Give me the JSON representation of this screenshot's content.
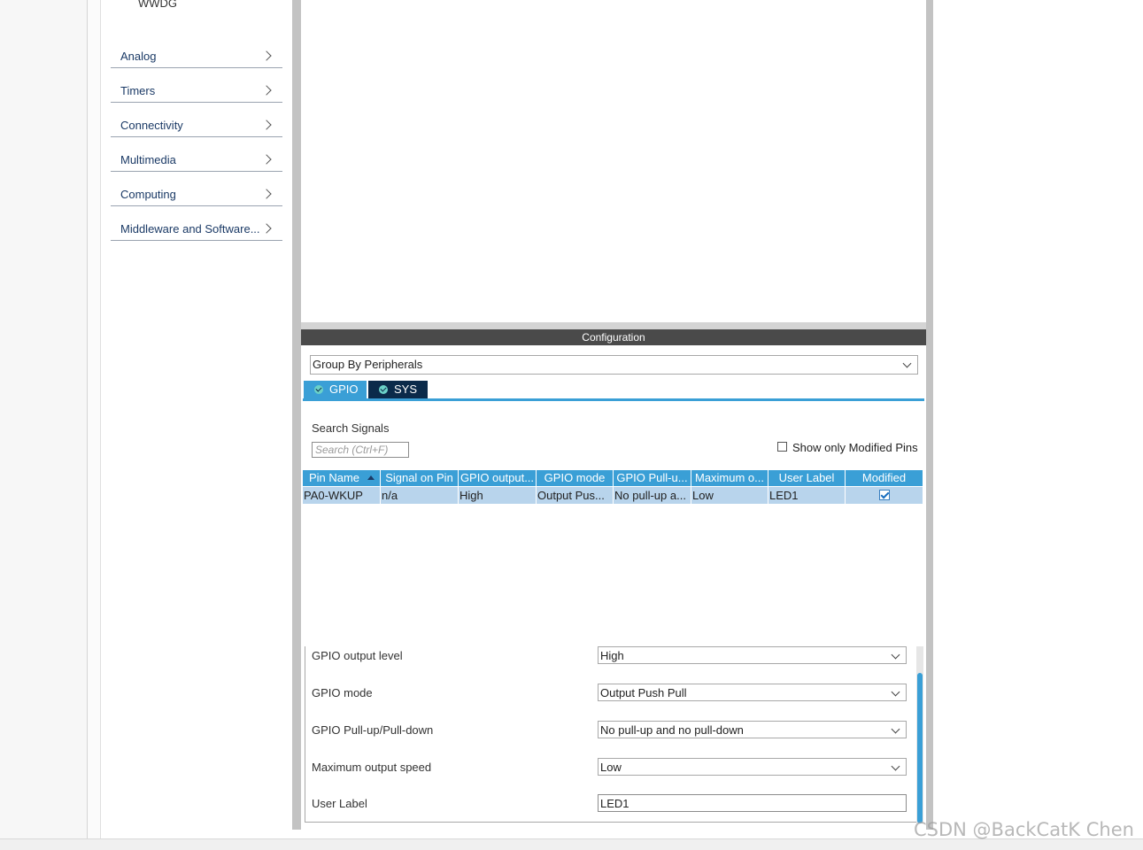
{
  "sidebar": {
    "partial_item": "WWDG",
    "categories": [
      {
        "label": "Analog"
      },
      {
        "label": "Timers"
      },
      {
        "label": "Connectivity"
      },
      {
        "label": "Multimedia"
      },
      {
        "label": "Computing"
      },
      {
        "label": "Middleware and Software..."
      }
    ]
  },
  "configuration": {
    "title": "Configuration",
    "group_by": "Group By Peripherals",
    "tabs": [
      {
        "label": "GPIO",
        "active": true
      },
      {
        "label": "SYS",
        "active": false
      }
    ],
    "search": {
      "title": "Search Signals",
      "placeholder": "Search (Ctrl+F)"
    },
    "show_modified_label": "Show only Modified Pins",
    "show_modified_checked": false,
    "table": {
      "headers": [
        "Pin Name",
        "Signal on Pin",
        "GPIO output...",
        "GPIO mode",
        "GPIO Pull-u...",
        "Maximum o...",
        "User Label",
        "Modified"
      ],
      "rows": [
        [
          "PA0-WKUP",
          "n/a",
          "High",
          "Output Pus...",
          "No pull-up a...",
          "Low",
          "LED1",
          "checked"
        ]
      ]
    },
    "properties": [
      {
        "label": "GPIO output level",
        "value": "High",
        "type": "select"
      },
      {
        "label": "GPIO mode",
        "value": "Output Push Pull",
        "type": "select"
      },
      {
        "label": "GPIO Pull-up/Pull-down",
        "value": "No pull-up and no pull-down",
        "type": "select"
      },
      {
        "label": "Maximum output speed",
        "value": "Low",
        "type": "select"
      },
      {
        "label": "User Label",
        "value": "LED1",
        "type": "input"
      }
    ]
  },
  "watermark": "CSDN @BackCatK Chen",
  "colors": {
    "accent": "#3a9fd6",
    "tab_dark": "#0b2a4a",
    "row_selected": "#b8d4ec",
    "header_dark": "#4a4a4a"
  }
}
